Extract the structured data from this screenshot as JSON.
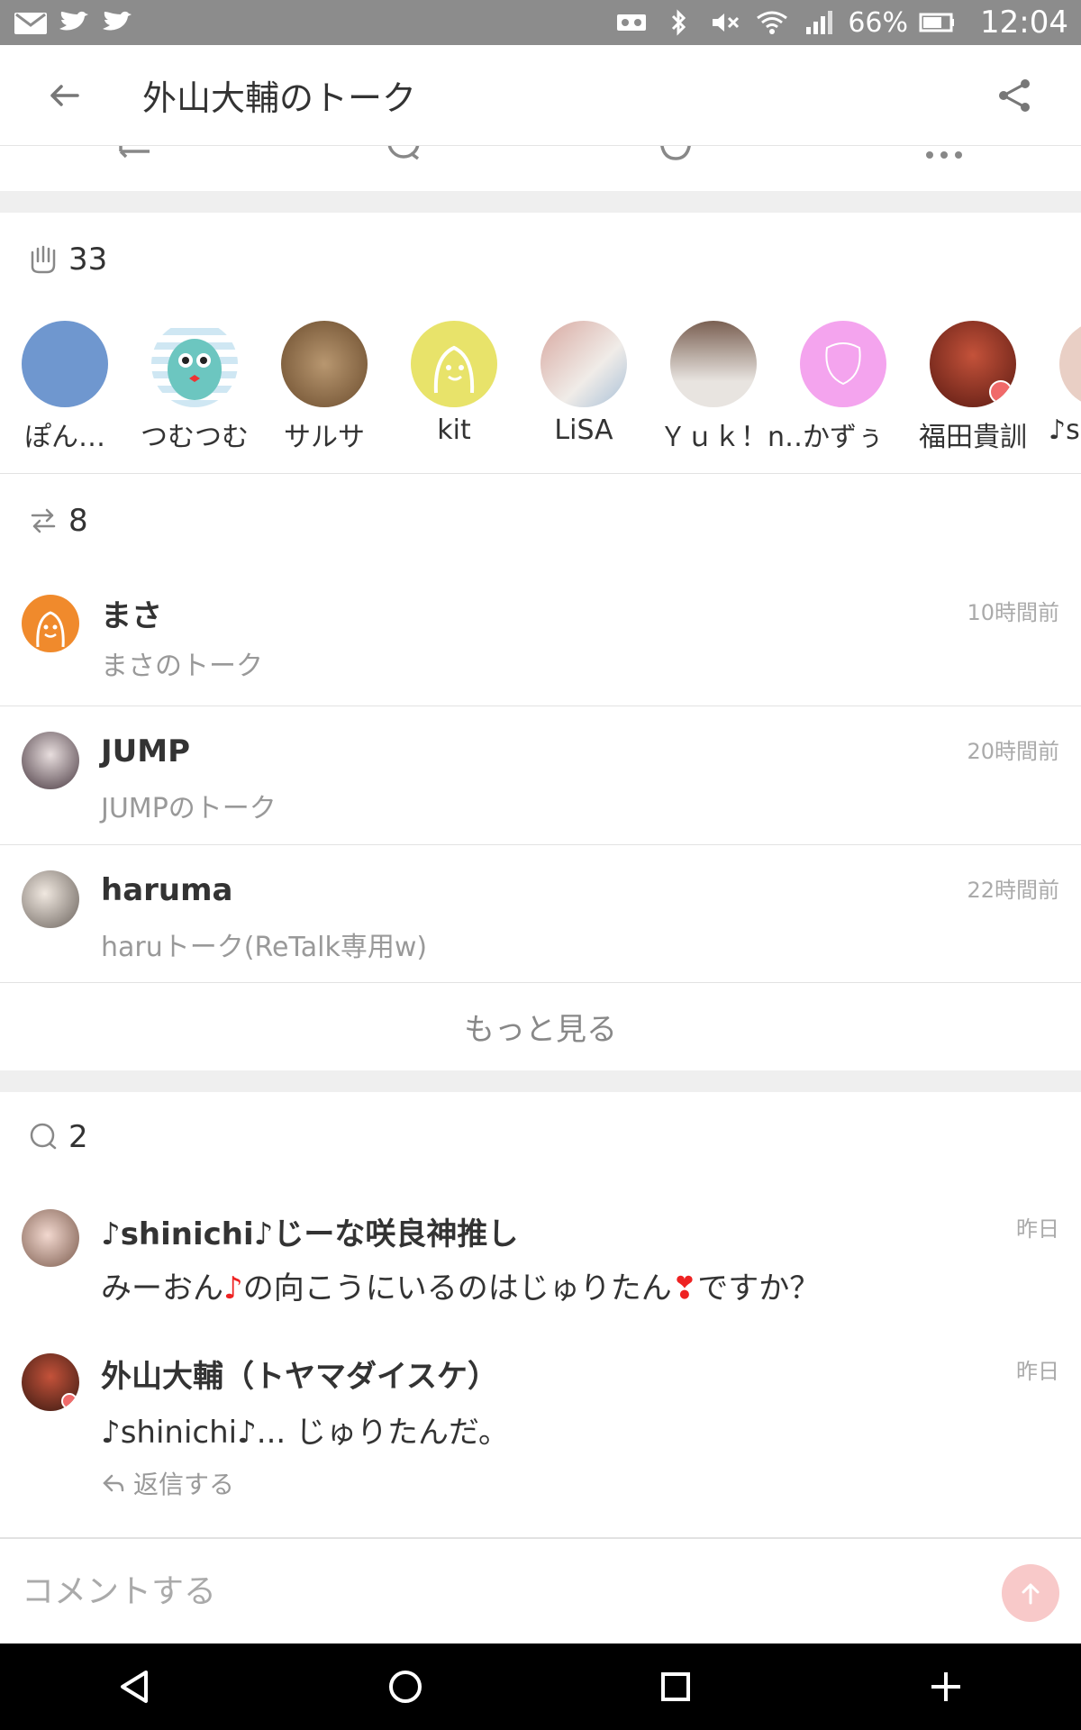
{
  "status_bar": {
    "battery": "66%",
    "time": "12:04",
    "icons": [
      "gmail-icon",
      "twitter-icon",
      "twitter-icon",
      "voicemail-icon",
      "bluetooth-icon",
      "mute-icon",
      "wifi-icon",
      "signal-icon",
      "battery-icon"
    ]
  },
  "header": {
    "title": "外山大輔のトーク",
    "back_icon": "arrow-left-icon",
    "share_icon": "share-icon"
  },
  "reactions": {
    "count": "33",
    "users": [
      {
        "name": "ぽん…",
        "color": "#6f97cf"
      },
      {
        "name": "つむつむ",
        "color": "#cfe7f3"
      },
      {
        "name": "サルサ",
        "color": "#8a6b4a"
      },
      {
        "name": "kit",
        "color": "#e8e36a"
      },
      {
        "name": "LiSA",
        "color": "#e0c8c8"
      },
      {
        "name": "Ｙｕｋ！n…",
        "color": "#9e8678"
      },
      {
        "name": "かずぅ",
        "color": "#f4a4ee"
      },
      {
        "name": "福田貴訓",
        "color": "#8c2b1e"
      },
      {
        "name": "♪s",
        "color": "#e9cfc5"
      }
    ]
  },
  "retalks": {
    "count": "8",
    "items": [
      {
        "user": "まさ",
        "talk": "まさのトーク",
        "time": "10時間前"
      },
      {
        "user": "JUMP",
        "talk": "JUMPのトーク",
        "time": "20時間前"
      },
      {
        "user": "haruma",
        "talk": "haruトーク(ReTalk専用w)",
        "time": "22時間前"
      }
    ],
    "more_label": "もっと見る"
  },
  "comments": {
    "count": "2",
    "items": [
      {
        "user": "♪shinichi♪じーな咲良神推し",
        "text_a": "みーおん",
        "text_b": "の向こうにいるのはじゅりたん",
        "text_c": "ですか？",
        "time": "昨日"
      },
      {
        "user": "外山大輔（トヤマダイスケ）",
        "text": "♪shinichi♪... じゅりたんだ。",
        "time": "昨日"
      }
    ],
    "reply_label": "返信する"
  },
  "input": {
    "placeholder": "コメントする"
  },
  "colors": {
    "accent": "#f08a2c",
    "send_button": "#f8c9c9",
    "muted_text": "#999999"
  }
}
